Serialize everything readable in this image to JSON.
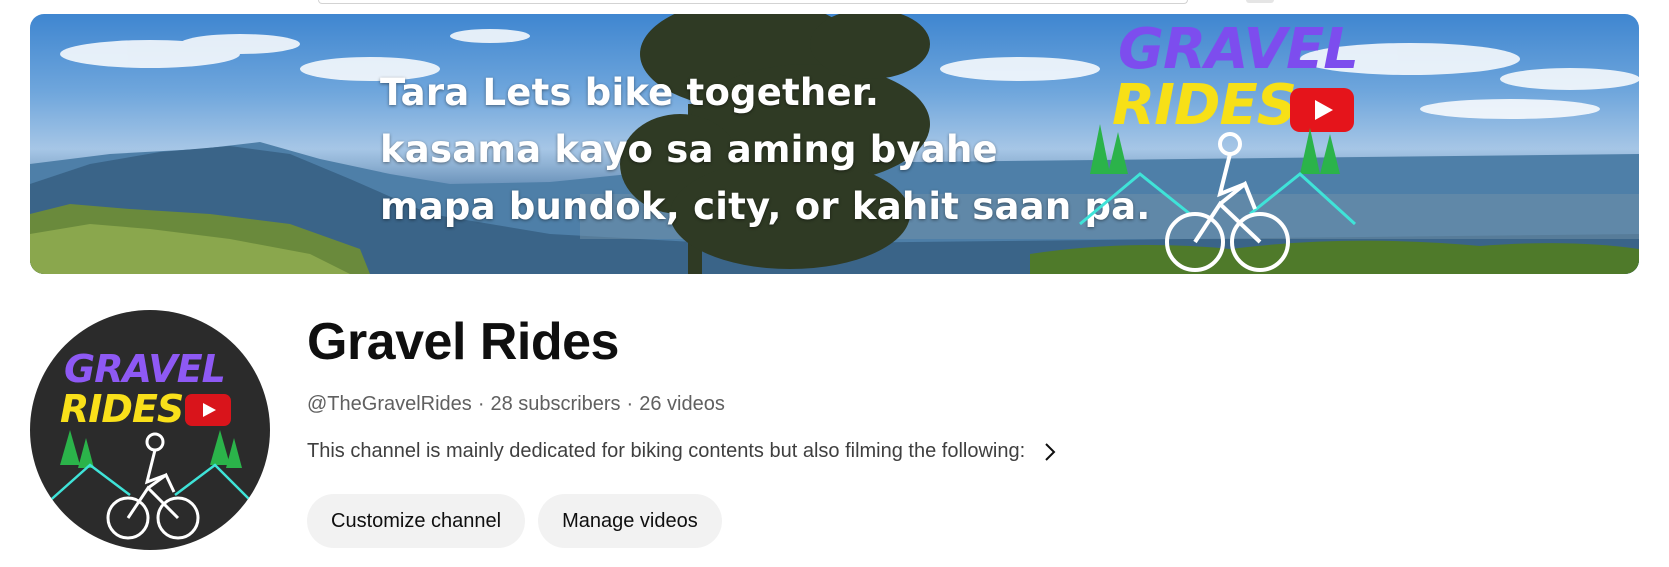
{
  "banner": {
    "lines": [
      "Tara Lets bike together.",
      "kasama kayo sa aming byahe",
      "mapa bundok, city, or kahit saan pa."
    ],
    "logo_line1": "GRAVEL",
    "logo_line2": "RIDES"
  },
  "avatar": {
    "logo_line1": "GRAVEL",
    "logo_line2": "RIDES"
  },
  "channel": {
    "name": "Gravel Rides",
    "handle": "@TheGravelRides",
    "subscribers": "28 subscribers",
    "videos": "26 videos",
    "separator": "·",
    "description": "This channel is mainly dedicated for biking contents but also filming the following:"
  },
  "buttons": {
    "customize": "Customize channel",
    "manage": "Manage videos"
  },
  "colors": {
    "logo_purple": "#7d4dee",
    "logo_yellow": "#f7e017",
    "youtube_red": "#e5141b",
    "button_bg": "#f2f2f2",
    "meta_text": "#606060"
  },
  "icons": {
    "description_expand": "chevron-right-icon",
    "logo_play": "youtube-play-icon"
  }
}
